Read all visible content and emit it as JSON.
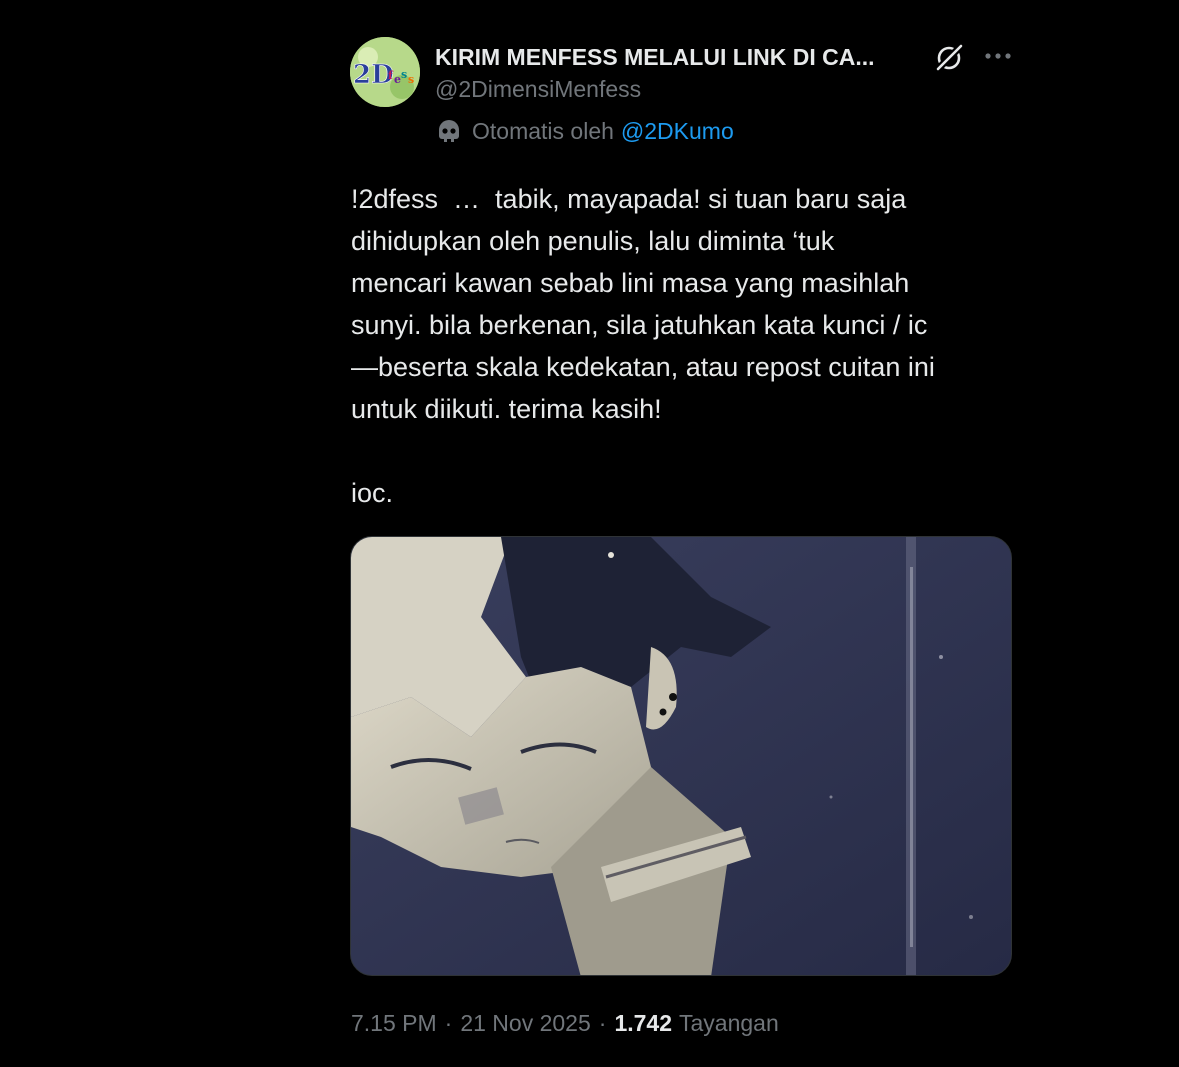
{
  "author": {
    "name": "KIRIM MENFESS MELALUI LINK DI CA...",
    "handle": "@2DimensiMenfess",
    "avatar_text": "2Dfess",
    "automated_prefix": "Otomatis oleh",
    "automated_by": "@2DKumo"
  },
  "icons": {
    "grok": "grok-icon",
    "more": "more-icon",
    "bot": "bot-icon"
  },
  "tweet": {
    "text": "!2dfess  …  tabik, mayapada! si tuan baru saja\ndihidupkan oleh penulis, lalu diminta ‘tuk\nmencari kawan sebab lini masa yang masihlah\nsunyi. bila berkenan, sila jatuhkan kata kunci / ic\n—beserta skala kedekatan, atau repost cuitan ini\nuntuk diikuti. terima kasih!\n\nioc."
  },
  "meta": {
    "time": "7.15 PM",
    "separator": "·",
    "date": "21 Nov 2025",
    "views_count": "1.742",
    "views_label": "Tayangan"
  },
  "colors": {
    "background": "#000000",
    "text": "#e7e9ea",
    "muted": "#71767b",
    "link": "#1d9bf0"
  }
}
